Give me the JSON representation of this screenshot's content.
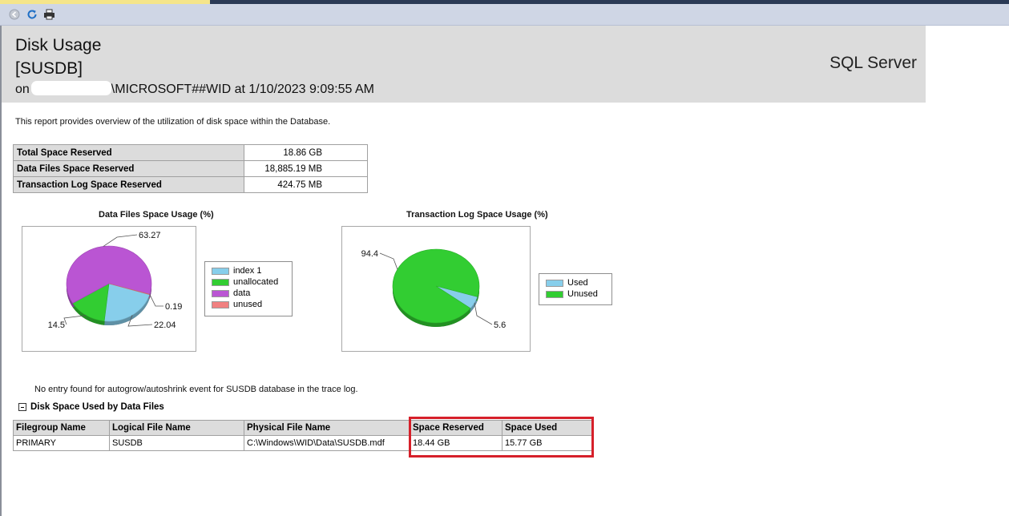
{
  "toolbar": {
    "back_icon": "back-arrow-icon",
    "refresh_icon": "refresh-icon",
    "print_icon": "print-icon"
  },
  "header": {
    "title": "Disk Usage",
    "database": "[SUSDB]",
    "on_prefix": "on",
    "instance_suffix": "\\MICROSOFT##WID at 1/10/2023 9:09:55 AM",
    "product": "SQL Server"
  },
  "description": "This report provides overview of the utilization of disk space within the Database.",
  "summary": [
    {
      "label": "Total Space Reserved",
      "value": "18.86 GB"
    },
    {
      "label": "Data Files Space Reserved",
      "value": "18,885.19 MB"
    },
    {
      "label": "Transaction Log Space Reserved",
      "value": "424.75 MB"
    }
  ],
  "chart_data": [
    {
      "type": "pie",
      "title": "Data Files Space Usage (%)",
      "labels": [
        "index 1",
        "unallocated",
        "data",
        "unused"
      ],
      "values": [
        22.04,
        14.5,
        63.27,
        0.19
      ],
      "colors": [
        "#87ceeb",
        "#32cd32",
        "#ba55d3",
        "#f08080"
      ],
      "value_labels": [
        "22.04",
        "14.5",
        "63.27",
        "0.19"
      ],
      "legend": "right"
    },
    {
      "type": "pie",
      "title": "Transaction Log Space Usage (%)",
      "labels": [
        "Used",
        "Unused"
      ],
      "values": [
        5.6,
        94.4
      ],
      "colors": [
        "#87ceeb",
        "#32cd32"
      ],
      "value_labels": [
        "5.6",
        "94.4"
      ],
      "legend": "right"
    }
  ],
  "autogrow_message": "No entry found for autogrow/autoshrink event for SUSDB database in the trace log.",
  "files_section": {
    "title": "Disk Space Used by Data Files",
    "columns": [
      "Filegroup Name",
      "Logical File Name",
      "Physical File Name",
      "Space Reserved",
      "Space Used"
    ],
    "rows": [
      [
        "PRIMARY",
        "SUSDB",
        "C:\\Windows\\WID\\Data\\SUSDB.mdf",
        "18.44 GB",
        "15.77 GB"
      ]
    ]
  },
  "colors": {
    "highlight_border": "#d6202a",
    "header_bg": "#dcdcdc",
    "toolbar_bg": "#cfd6e5"
  }
}
